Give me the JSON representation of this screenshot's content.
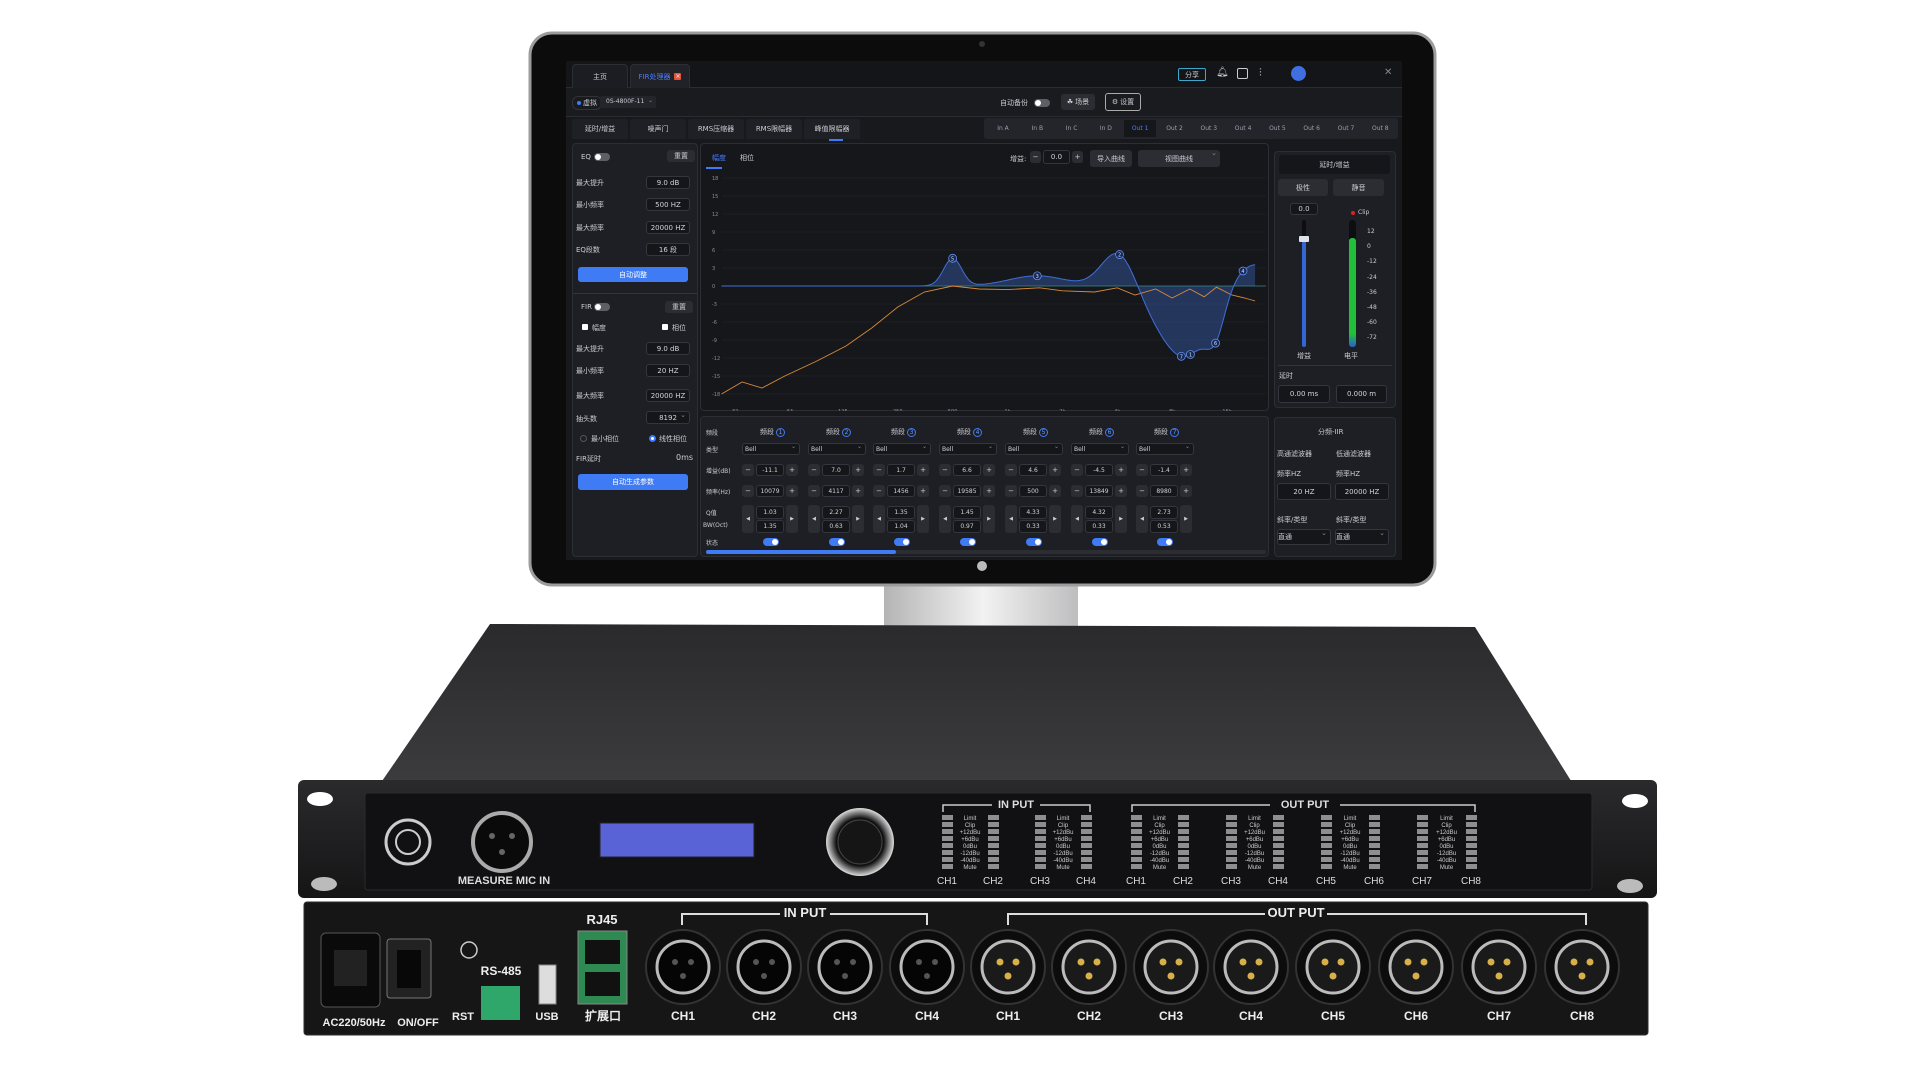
{
  "screen": {
    "tabs": [
      {
        "label": "主页"
      },
      {
        "label": "FIR处理器",
        "active": true
      }
    ],
    "share_label": "分享",
    "icons": [
      "bell-icon",
      "store-icon",
      "mixer-icon",
      "user-avatar-icon",
      "close-icon"
    ],
    "device": {
      "status": "虚拟",
      "model": "0S-4800F-11"
    },
    "nav": [
      {
        "label": "声场测量"
      },
      {
        "label": "路由"
      },
      {
        "label": "音频处理",
        "active": true
      }
    ],
    "auto_backup_label": "自动备份",
    "auto_backup_on": false,
    "scene_label": "场景",
    "settings_label": "设置",
    "subtabs": [
      "延时/增益",
      "噪声门",
      "RMS压缩器",
      "RMS限幅器",
      "峰值限幅器"
    ],
    "channels": [
      "In A",
      "In B",
      "In C",
      "In D",
      "Out 1",
      "Out 2",
      "Out 3",
      "Out 4",
      "Out 5",
      "Out 6",
      "Out 7",
      "Out 8"
    ],
    "active_channel": "Out 1",
    "accent_color": "#3f7bf5",
    "left": {
      "eq": {
        "label": "EQ",
        "enabled": false,
        "reset": "重置",
        "max_boost_label": "最大提升",
        "max_boost": "9.0 dB",
        "min_freq_label": "最小频率",
        "min_freq": "500 HZ",
        "max_freq_label": "最大频率",
        "max_freq": "20000 HZ",
        "bands_label": "EQ段数",
        "bands": "16 段",
        "auto_button": "自动调整"
      },
      "fir": {
        "label": "FIR",
        "enabled": false,
        "reset": "重置",
        "amp_label": "幅度",
        "phase_label": "相位",
        "max_boost_label": "最大提升",
        "max_boost": "9.0 dB",
        "min_freq_label": "最小频率",
        "min_freq": "20 HZ",
        "max_freq_label": "最大频率",
        "max_freq": "20000 HZ",
        "taps_label": "抽头数",
        "taps": "8192",
        "min_phase_label": "最小相位",
        "linear_phase_label": "线性相位",
        "phase_mode": "线性相位",
        "delay_label": "FIR延时",
        "delay": "0ms",
        "generate_button": "自动生成参数"
      }
    },
    "graph": {
      "tabs": [
        "幅度",
        "相位"
      ],
      "gain_label": "增益:",
      "gain": "0.0",
      "import_button": "导入曲线",
      "view_select": "视图曲线"
    },
    "table": {
      "row_labels": [
        "频段",
        "类型",
        "增益(dB)",
        "频率(Hz)",
        "Q值",
        "BW(Oct)",
        "状态"
      ],
      "band_label": "频段",
      "scroll_fraction": 0.34
    },
    "right": {
      "title": "延时/增益",
      "polarity": "极性",
      "mute": "静音",
      "gain_value": "0.0",
      "clip_label": "Clip",
      "scale": [
        "12",
        "0",
        "-12",
        "-24",
        "-36",
        "-48",
        "-60",
        "-72"
      ],
      "gain_label": "增益",
      "level_label": "电平",
      "gain_slider_db": 0.0,
      "level_db": 0,
      "delay_label": "延时",
      "delay_ms": "0.00   ms",
      "delay_m": "0.000   m",
      "crossover": {
        "title": "分频-IIR",
        "hp_label": "高通滤波器",
        "lp_label": "低通滤波器",
        "freq_label": "频率HZ",
        "hp_freq": "20   HZ",
        "lp_freq": "20000   HZ",
        "slope_label": "斜率/类型",
        "hp_type": "直通",
        "lp_type": "直通"
      }
    }
  },
  "chart_data": {
    "type": "line",
    "x_scale": "log",
    "xlim": [
      27,
      22800
    ],
    "ylim": [
      -18,
      18
    ],
    "x_ticks": [
      {
        "v": 32,
        "label": "32"
      },
      {
        "v": 64,
        "label": "64"
      },
      {
        "v": 125,
        "label": "125"
      },
      {
        "v": 250,
        "label": "250"
      },
      {
        "v": 500,
        "label": "500"
      },
      {
        "v": 1000,
        "label": "1k"
      },
      {
        "v": 2000,
        "label": "2k"
      },
      {
        "v": 4000,
        "label": "4k"
      },
      {
        "v": 8000,
        "label": "8k"
      },
      {
        "v": 16000,
        "label": "16k"
      }
    ],
    "y_ticks": [
      18,
      15,
      12,
      9,
      6,
      3,
      0,
      -3,
      -6,
      -9,
      -12,
      -15,
      -18
    ],
    "grid": true,
    "bands": [
      {
        "n": "1",
        "type": "Bell",
        "gain": "-11.1",
        "freq": "10079",
        "q": "1.03",
        "bw": "1.35",
        "on": true
      },
      {
        "n": "2",
        "type": "Bell",
        "gain": "7.0",
        "freq": "4117",
        "q": "2.27",
        "bw": "0.63",
        "on": true
      },
      {
        "n": "3",
        "type": "Bell",
        "gain": "1.7",
        "freq": "1456",
        "q": "1.35",
        "bw": "1.04",
        "on": true
      },
      {
        "n": "4",
        "type": "Bell",
        "gain": "6.6",
        "freq": "19585",
        "q": "1.45",
        "bw": "0.97",
        "on": true
      },
      {
        "n": "5",
        "type": "Bell",
        "gain": "4.6",
        "freq": "500",
        "q": "4.33",
        "bw": "0.33",
        "on": true
      },
      {
        "n": "6",
        "type": "Bell",
        "gain": "-4.5",
        "freq": "13849",
        "q": "4.32",
        "bw": "0.33",
        "on": true
      },
      {
        "n": "7",
        "type": "Bell",
        "gain": "-1.4",
        "freq": "8980",
        "q": "2.73",
        "bw": "0.53",
        "on": true
      }
    ],
    "measured": [
      [
        27,
        -18
      ],
      [
        35,
        -16
      ],
      [
        45,
        -17
      ],
      [
        60,
        -15
      ],
      [
        90,
        -12.5
      ],
      [
        130,
        -10
      ],
      [
        180,
        -7
      ],
      [
        250,
        -3.5
      ],
      [
        350,
        -1
      ],
      [
        500,
        0
      ],
      [
        700,
        -0.5
      ],
      [
        1000,
        -0.6
      ],
      [
        1500,
        -0.3
      ],
      [
        2000,
        -0.8
      ],
      [
        3000,
        -1
      ],
      [
        4000,
        -0.3
      ],
      [
        5000,
        -1.5
      ],
      [
        6500,
        -0.5
      ],
      [
        8000,
        -2
      ],
      [
        10000,
        -0.5
      ],
      [
        12000,
        -1.8
      ],
      [
        14000,
        -0.2
      ],
      [
        17000,
        -1.5
      ],
      [
        20000,
        -2
      ],
      [
        22800,
        -2.5
      ]
    ],
    "eq_color": "#3f6fd8",
    "measured_color": "#d98a3a"
  },
  "hardware": {
    "front": {
      "mic_label": "MEASURE MIC IN",
      "input_label": "IN PUT",
      "output_label": "OUT PUT",
      "meter_levels": [
        "Limit",
        "Clip",
        "+12dBu",
        "+6dBu",
        "0dBu",
        "-12dBu",
        "-40dBu",
        "Mute"
      ],
      "input_channels": [
        "CH1",
        "CH2",
        "CH3",
        "CH4"
      ],
      "output_channels": [
        "CH1",
        "CH2",
        "CH3",
        "CH4",
        "CH5",
        "CH6",
        "CH7",
        "CH8"
      ],
      "lcd_color": "#5a63d6"
    },
    "rear": {
      "power_label": "AC220/50Hz",
      "switch_label": "ON/OFF",
      "rs485_label": "RS-485",
      "rst_label": "RST",
      "usb_label": "USB",
      "rj45_label": "RJ45",
      "expansion_label": "扩展口",
      "input_label": "IN PUT",
      "output_label": "OUT PUT",
      "input_channels": [
        "CH1",
        "CH2",
        "CH3",
        "CH4"
      ],
      "output_channels": [
        "CH1",
        "CH2",
        "CH3",
        "CH4",
        "CH5",
        "CH6",
        "CH7",
        "CH8"
      ]
    }
  }
}
